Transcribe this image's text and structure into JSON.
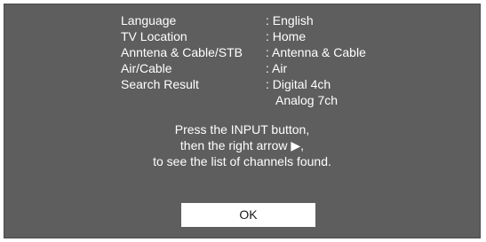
{
  "settings": {
    "rows": [
      {
        "label": "Language",
        "value": ": English"
      },
      {
        "label": "TV Location",
        "value": ": Home"
      },
      {
        "label": "Anntena & Cable/STB",
        "value": ": Antenna & Cable"
      },
      {
        "label": "Air/Cable",
        "value": ": Air"
      },
      {
        "label": "Search Result",
        "value": ": Digital 4ch",
        "value2": "Analog 7ch"
      }
    ]
  },
  "message": {
    "line1": "Press the INPUT button,",
    "line2": "then the right arrow ▶,",
    "line3": "to see the list of channels found."
  },
  "ok_label": "OK",
  "colors": {
    "panel_bg": "#5e5e5e",
    "text": "#ffffff",
    "button_bg": "#ffffff",
    "button_text": "#1a1a1a"
  }
}
